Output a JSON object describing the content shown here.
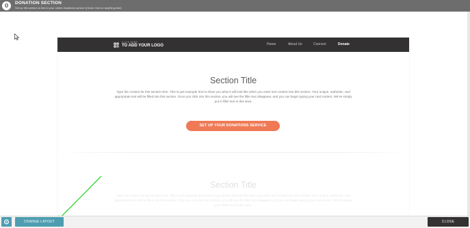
{
  "header": {
    "badge": "0",
    "title": "DONATION SECTION",
    "subtitle": "Set up this section to link to your online donations service (Clover Give or anything else)"
  },
  "preview": {
    "logo": {
      "small_text": "CLICK HERE",
      "big_text": "TO ADD YOUR LOGO"
    },
    "nav": {
      "items": [
        "Home",
        "About Us",
        "Connect",
        "Donate"
      ],
      "active": "Donate"
    },
    "section1": {
      "title": "Section Title",
      "body": "Type the content for this section here. This is just example text to show you what it will look like when you enter text content into this section. Your unique, authentic, and appropriate text will be filled into this section. Once you click into this section, you will see the filler text disappear, and you can begin typing your real content. We've simply put in filler text in this area.",
      "button_label": "SET UP YOUR DONATIONS SERVICE"
    },
    "section2": {
      "title": "Section Title",
      "body": "Type the content for this section here. This is just example text to show you what it will look like when you enter text content into this section. Your unique, authentic, and appropriate text will be filled into this section. Once you click into this section, you will see the filler text disappear, and you can begin typing your real content. We've simply put in filler text in this area."
    }
  },
  "footer": {
    "change_layout_label": "CHANGE LAYOUT",
    "close_label": "CLOSE"
  },
  "colors": {
    "accent": "#f07a56",
    "teal": "#4e9db1",
    "dark": "#333132",
    "annotation_arrow": "#3fd63a"
  }
}
